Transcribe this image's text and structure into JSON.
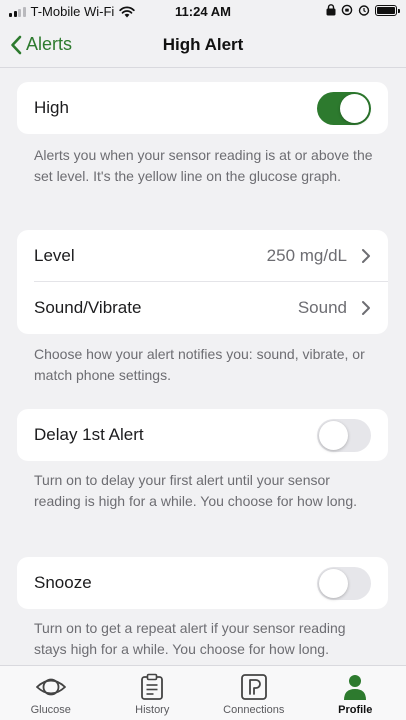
{
  "status_bar": {
    "carrier": "T-Mobile Wi-Fi",
    "time": "11:24 AM"
  },
  "nav": {
    "back_label": "Alerts",
    "title": "High Alert"
  },
  "high_toggle": {
    "label": "High",
    "on": true,
    "note": "Alerts you when your sensor reading is at or above the set level. It's the yellow line on the glucose graph."
  },
  "settings": {
    "level_label": "Level",
    "level_value": "250 mg/dL",
    "sound_label": "Sound/Vibrate",
    "sound_value": "Sound",
    "note": "Choose how your alert notifies you: sound, vibrate, or match phone settings."
  },
  "delay": {
    "label": "Delay 1st Alert",
    "on": false,
    "note": "Turn on to delay your first alert until your sensor reading is high for a while. You choose for how long."
  },
  "snooze": {
    "label": "Snooze",
    "on": false,
    "note": "Turn on to get a repeat alert if your sensor reading stays high for a while. You choose for how long."
  },
  "tabs": [
    {
      "label": "Glucose",
      "icon": "glucose-icon"
    },
    {
      "label": "History",
      "icon": "history-icon"
    },
    {
      "label": "Connections",
      "icon": "connections-icon"
    },
    {
      "label": "Profile",
      "icon": "profile-icon",
      "active": true
    }
  ],
  "colors": {
    "accent": "#2d7a2e",
    "background": "#f1f1f3"
  }
}
